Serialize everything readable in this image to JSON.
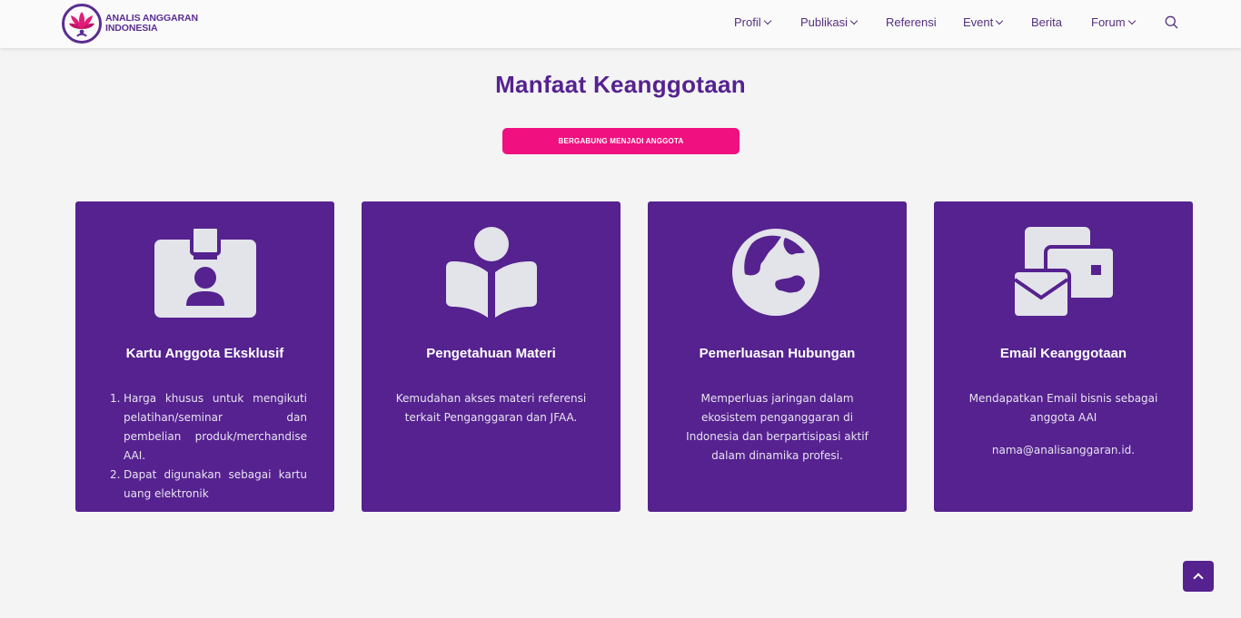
{
  "brand": {
    "line1": "ANALIS ANGGARAN",
    "line2": "INDONESIA"
  },
  "nav": {
    "items": [
      {
        "label": "Profil",
        "dropdown": true
      },
      {
        "label": "Publikasi",
        "dropdown": true
      },
      {
        "label": "Referensi",
        "dropdown": false
      },
      {
        "label": "Event",
        "dropdown": true
      },
      {
        "label": "Berita",
        "dropdown": false
      },
      {
        "label": "Forum",
        "dropdown": true
      }
    ]
  },
  "section": {
    "title": "Manfaat Keanggotaan",
    "join_label": "BERGABUNG MENJADI ANGGOTA"
  },
  "cards": [
    {
      "title": "Kartu Anggota Eksklusif",
      "icon": "id-badge-icon",
      "list": [
        {
          "num": "1.",
          "text": "Harga khusus untuk mengikuti pelatihan/seminar dan pembelian produk/merchandise AAI."
        },
        {
          "num": "2.",
          "text": "Dapat digunakan sebagai kartu uang elektronik"
        }
      ]
    },
    {
      "title": "Pengetahuan Materi",
      "icon": "book-reader-icon",
      "desc": "Kemudahan akses materi referensi terkait Penganggaran dan JFAA."
    },
    {
      "title": "Pemerluasan Hubungan",
      "icon": "globe-icon",
      "desc": "Memperluas jaringan dalam ekosistem penganggaran di Indonesia dan berpartisipasi aktif dalam dinamika profesi."
    },
    {
      "title": "Email Keanggotaan",
      "icon": "mail-bulk-icon",
      "desc": "Mendapatkan Email bisnis sebagai anggota AAI",
      "desc2": "nama@analisanggaran.id."
    }
  ],
  "colors": {
    "primary": "#55228f",
    "accent": "#f0107f",
    "icon": "#e3e3ea"
  }
}
